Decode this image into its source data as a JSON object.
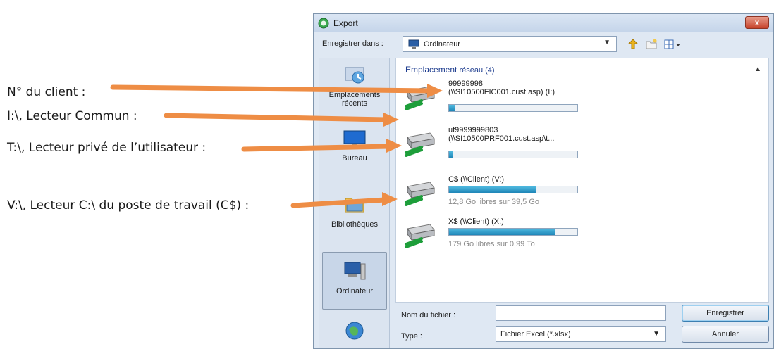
{
  "annotations": {
    "client_no": "N° du client :",
    "drive_i": "I:\\, Lecteur Commun :",
    "drive_t": "T:\\, Lecteur privé de l’utilisateur :",
    "drive_v": "V:\\, Lecteur C:\\ du poste de travail (C$) :"
  },
  "colors": {
    "arrow": "#ee8d45",
    "bar_fill": "#2a95c5",
    "group_header": "#1e3d8f"
  },
  "dialog": {
    "title": "Export",
    "close_label": "x",
    "save_in_label": "Enregistrer dans :",
    "location": "Ordinateur",
    "places": [
      {
        "label_line1": "Emplacements",
        "label_line2": "récents",
        "icon": "recent-places-icon"
      },
      {
        "label_line1": "Bureau",
        "icon": "desktop-icon"
      },
      {
        "label_line1": "Bibliothèques",
        "icon": "libraries-icon"
      },
      {
        "label_line1": "Ordinateur",
        "icon": "computer-icon"
      },
      {
        "label_line1": "",
        "icon": "network-icon"
      }
    ],
    "group_header_a": "Emplacement",
    "group_header_b": "réseau (4)",
    "drives": [
      {
        "line1": "99999998",
        "line2": "(\\\\SI10500FIC001.cust.asp) (I:)",
        "free": "",
        "fill": 0.05
      },
      {
        "line1": "uf9999999803",
        "line2": "(\\\\SI10500PRF001.cust.asp\\t...",
        "free": "",
        "fill": 0.03
      },
      {
        "line1": "C$ (\\\\Client) (V:)",
        "line2": "",
        "free": "12,8 Go libres sur 39,5 Go",
        "fill": 0.68
      },
      {
        "line1": "X$ (\\\\Client) (X:)",
        "line2": "",
        "free": "179 Go libres sur 0,99 To",
        "fill": 0.83
      }
    ],
    "filename_label": "Nom du fichier :",
    "filename_value": "",
    "type_label": "Type :",
    "type_value": "Fichier Excel (*.xlsx)",
    "save_button": "Enregistrer",
    "cancel_button": "Annuler"
  }
}
